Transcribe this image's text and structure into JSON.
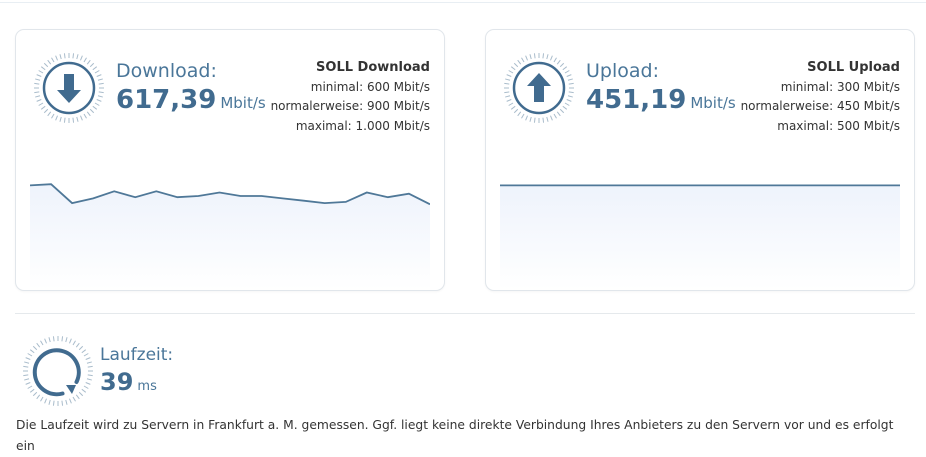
{
  "download": {
    "label": "Download:",
    "value": "617,39",
    "unit": "Mbit/s",
    "soll_title": "SOLL Download",
    "minimal": "minimal: 600 Mbit/s",
    "normal": "normalerweise: 900 Mbit/s",
    "maximal": "maximal: 1.000 Mbit/s",
    "icon": "arrow-down-icon",
    "sparkline": [
      0.7,
      0.71,
      0.55,
      0.59,
      0.65,
      0.6,
      0.65,
      0.6,
      0.61,
      0.64,
      0.61,
      0.61,
      0.59,
      0.57,
      0.55,
      0.56,
      0.64,
      0.6,
      0.63,
      0.54
    ]
  },
  "upload": {
    "label": "Upload:",
    "value": "451,19",
    "unit": "Mbit/s",
    "soll_title": "SOLL Upload",
    "minimal": "minimal: 300 Mbit/s",
    "normal": "normalerweise: 450 Mbit/s",
    "maximal": "maximal: 500 Mbit/s",
    "icon": "arrow-up-icon",
    "sparkline": [
      0.7,
      0.7,
      0.7,
      0.7,
      0.7,
      0.7
    ]
  },
  "laufzeit": {
    "label": "Laufzeit:",
    "value": "39",
    "unit": "ms",
    "icon": "refresh-icon",
    "note": "Die Laufzeit wird zu Servern in Frankfurt a. M. gemessen. Ggf. liegt keine direkte Verbindung Ihres Anbieters zu den Servern vor und es erfolgt ein"
  },
  "colors": {
    "accent": "#416b8f",
    "line": "#4f7898",
    "fill_top": "#eef3fc"
  }
}
